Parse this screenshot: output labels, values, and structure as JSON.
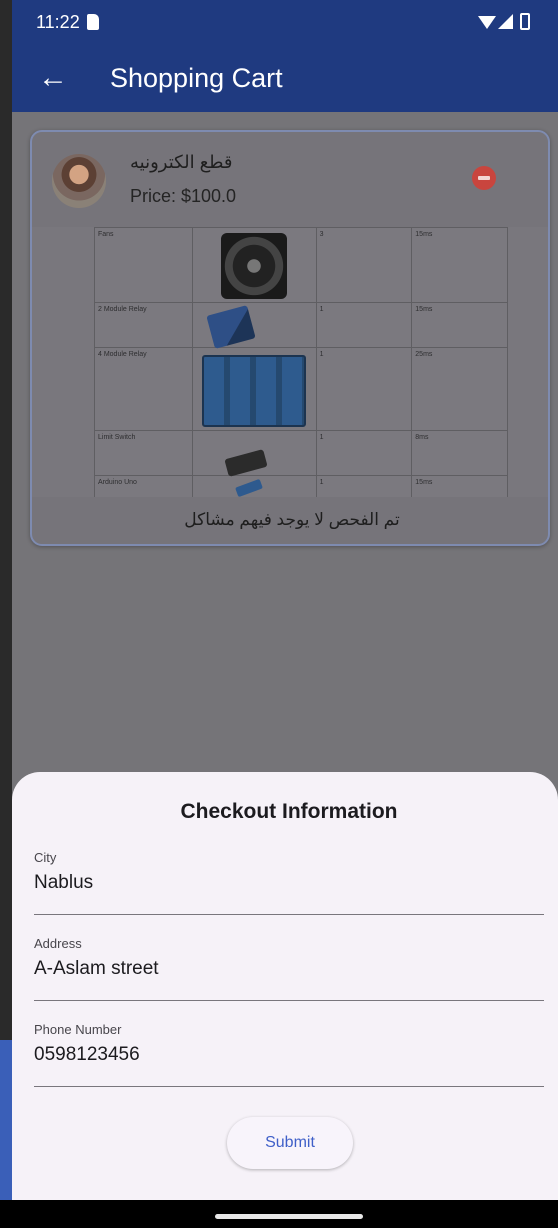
{
  "status_bar": {
    "time": "11:22",
    "icons": [
      "sd-card-icon",
      "wifi-icon",
      "signal-icon",
      "battery-icon"
    ]
  },
  "app_bar": {
    "back_icon": "arrow-left-icon",
    "title": "Shopping Cart"
  },
  "cart_item": {
    "name": "قطع الكترونيه",
    "price": "Price: $100.0",
    "remove_icon": "minus-circle-icon",
    "description": "تم الفحص لا يوجد فيهم مشاكل",
    "photo_table": {
      "rows": [
        {
          "name": "Fans",
          "qty": "3",
          "time": "15ms"
        },
        {
          "name": "2 Module Relay",
          "qty": "1",
          "time": "15ms"
        },
        {
          "name": "4 Module Relay",
          "qty": "1",
          "time": "25ms"
        },
        {
          "name": "Limit Switch",
          "qty": "1",
          "time": "8ms"
        },
        {
          "name": "Arduino Uno",
          "qty": "1",
          "time": "15ms"
        }
      ]
    }
  },
  "checkout": {
    "title": "Checkout Information",
    "fields": [
      {
        "label": "City",
        "value": "Nablus"
      },
      {
        "label": "Address",
        "value": "A-Aslam street"
      },
      {
        "label": "Phone Number",
        "value": "0598123456"
      }
    ],
    "submit_label": "Submit"
  },
  "colors": {
    "app_bar": "#1f3a80",
    "scrim": "#757478",
    "sheet": "#f6f2f8",
    "accent": "#3f5fc8",
    "remove": "#c9453e"
  }
}
